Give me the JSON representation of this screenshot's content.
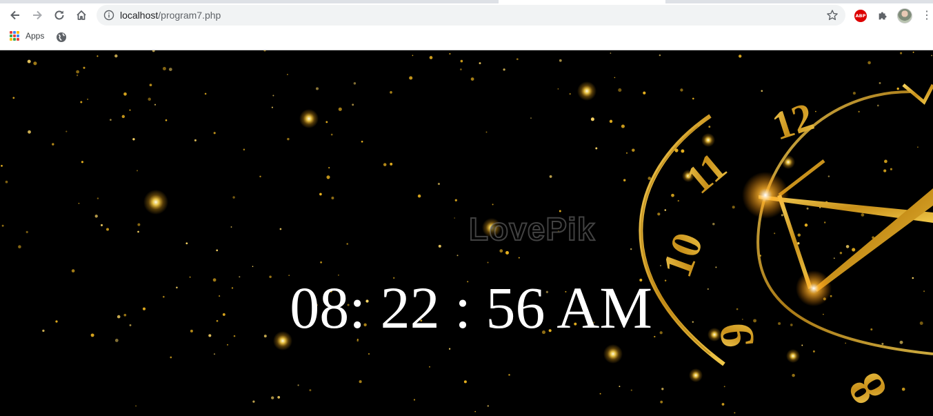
{
  "browser": {
    "url_host": "localhost",
    "url_path": "/program7.php",
    "bookmarks": {
      "apps_label": "Apps"
    },
    "extensions": {
      "adblock_label": "ABP"
    },
    "icons": [
      "back-icon",
      "forward-icon",
      "reload-icon",
      "home-icon",
      "site-info-icon",
      "bookmark-star-icon",
      "adblock-icon",
      "extensions-puzzle-icon",
      "profile-avatar",
      "menu-dots-icon",
      "apps-grid-icon",
      "globe-icon"
    ]
  },
  "page": {
    "time_text": "08: 22 : 56 AM",
    "watermark": "LovePik",
    "clock_numerals": [
      "12",
      "11",
      "10",
      "9",
      "8"
    ],
    "colors": {
      "background": "#000000",
      "gold": "#d9a21b",
      "time_text": "#ffffff"
    }
  }
}
